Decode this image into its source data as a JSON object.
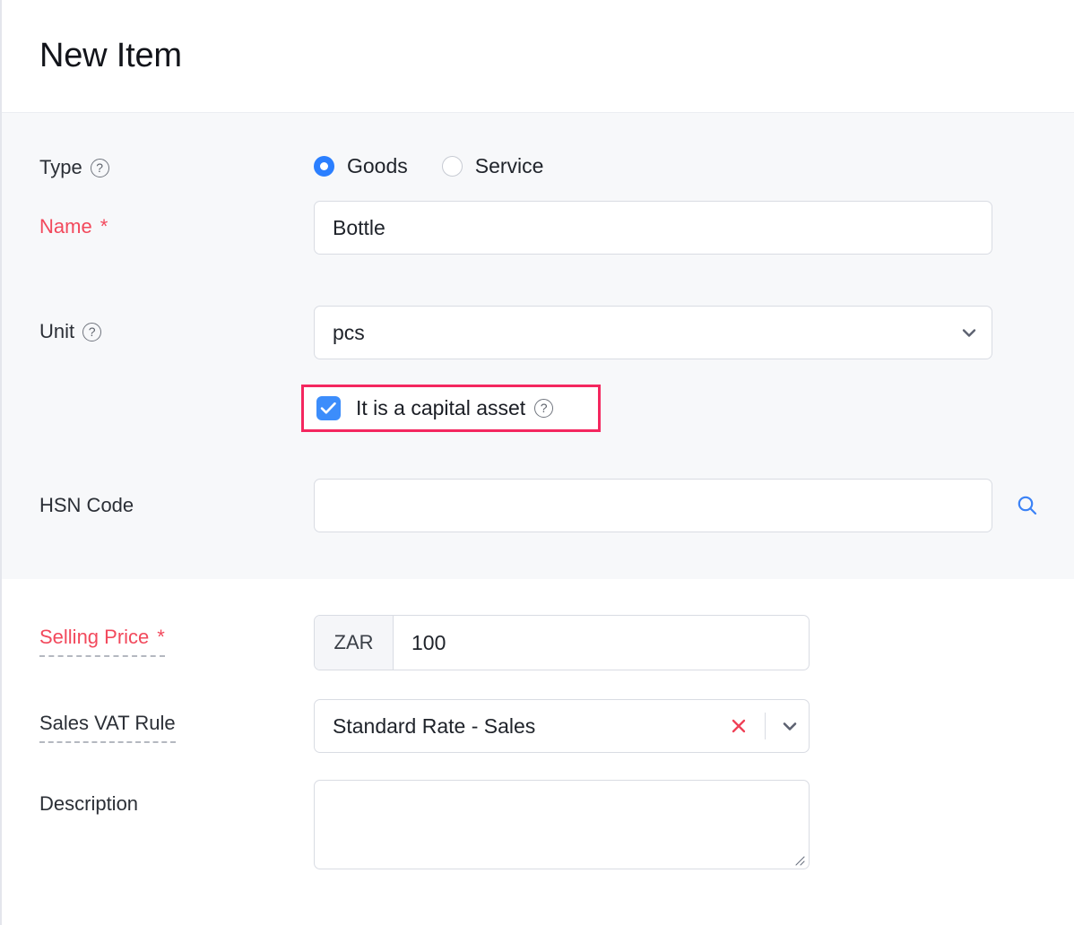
{
  "header": {
    "title": "New Item"
  },
  "form": {
    "type": {
      "label": "Type",
      "help_icon": "help-circle-icon",
      "options": [
        {
          "label": "Goods",
          "selected": true
        },
        {
          "label": "Service",
          "selected": false
        }
      ]
    },
    "name": {
      "label": "Name",
      "required_mark": "*",
      "value": "Bottle",
      "placeholder": ""
    },
    "unit": {
      "label": "Unit",
      "help_icon": "help-circle-icon",
      "value": "pcs",
      "dropdown_icon": "chevron-down-icon"
    },
    "capital_asset": {
      "label": "It is a capital asset",
      "checked": true,
      "check_icon": "check-icon",
      "help_icon": "help-circle-icon",
      "highlight_color": "#f4275f"
    },
    "hsn_code": {
      "label": "HSN Code",
      "value": "",
      "placeholder": "",
      "search_icon": "search-icon",
      "search_icon_color": "#3b82f6"
    },
    "selling_price": {
      "label": "Selling Price",
      "required_mark": "*",
      "currency": "ZAR",
      "value": "100",
      "placeholder": ""
    },
    "sales_vat_rule": {
      "label": "Sales VAT Rule",
      "value": "Standard Rate - Sales",
      "clear_icon": "close-x-icon",
      "clear_icon_color": "#ef4056",
      "dropdown_icon": "chevron-down-icon"
    },
    "description": {
      "label": "Description",
      "value": "",
      "placeholder": "",
      "resize_handle_icon": "resize-grip-icon"
    }
  },
  "colors": {
    "accent_blue": "#2b7fff",
    "required_red": "#f2495c",
    "section_bg": "#f7f8fa",
    "border": "#d9dce3"
  }
}
